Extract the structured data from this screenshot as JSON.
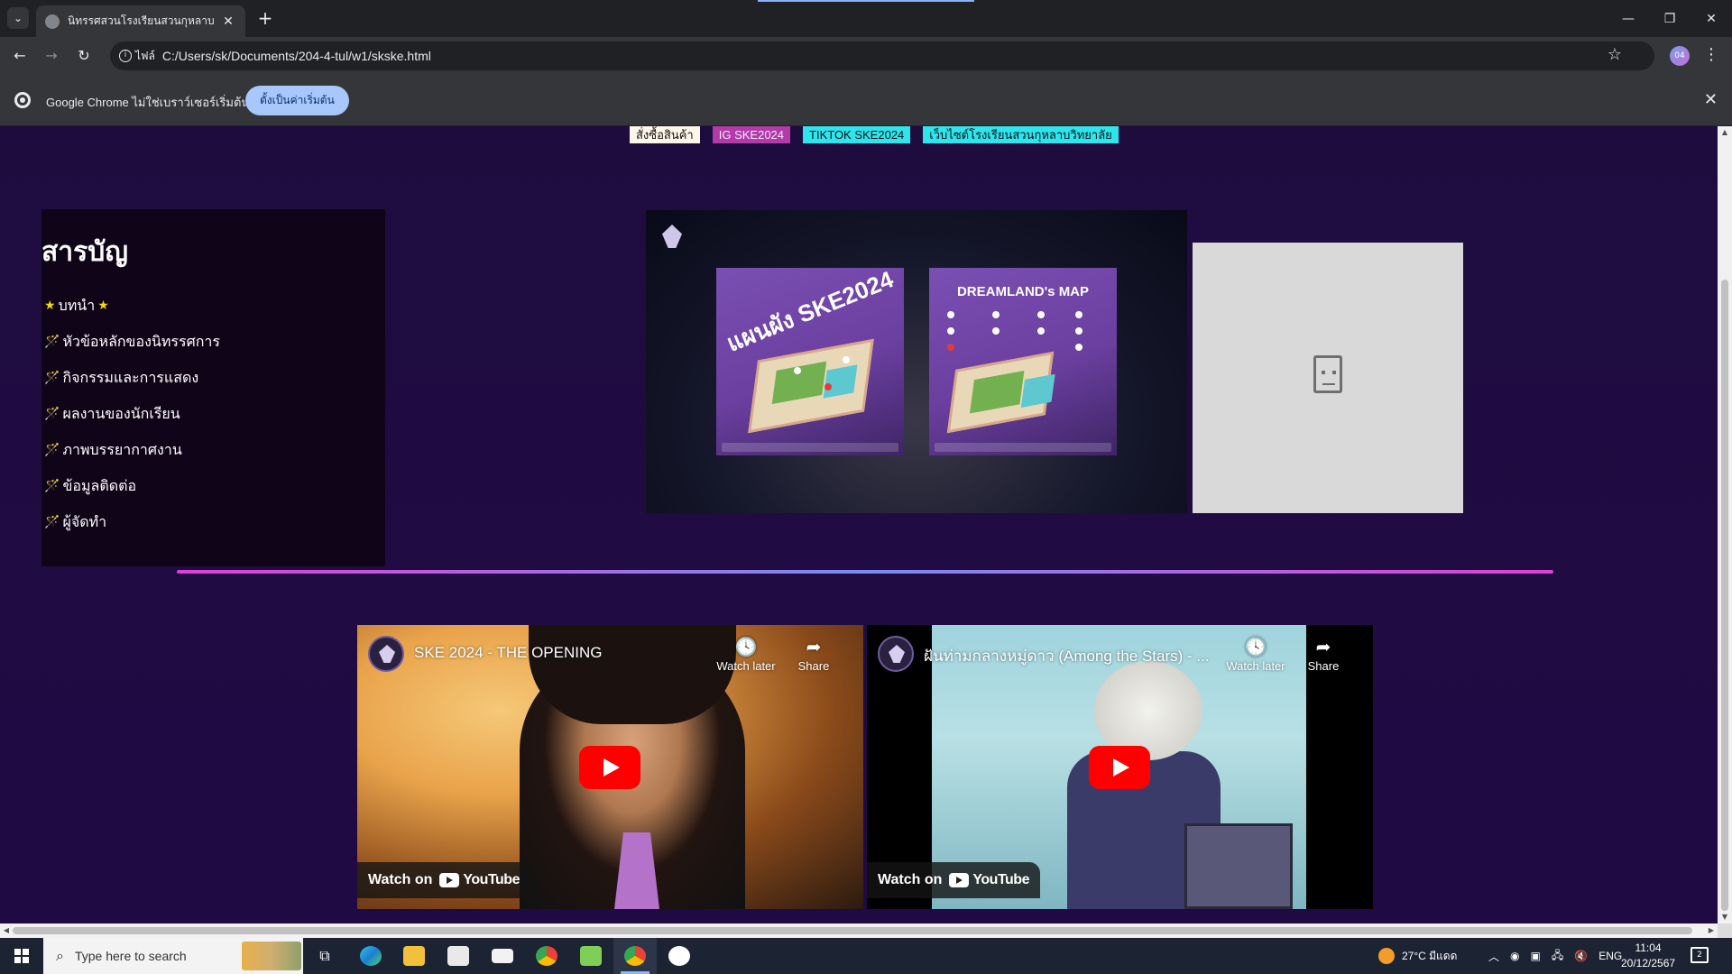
{
  "browser": {
    "tab_title": "นิทรรศสวนโรงเรียนสวนกุหลาบ",
    "address_scheme": "ไฟล์",
    "url": "C:/Users/sk/Documents/204-4-tul/w1/skske.html",
    "profile_label": "04",
    "infobar_text": "Google Chrome ไม่ใช่เบราว์เซอร์เริ่มต้น",
    "infobar_button": "ตั้งเป็นค่าเริ่มต้น"
  },
  "page": {
    "top_links": [
      "สั่งซื้อสินค้า",
      "IG SKE2024",
      "TIKTOK SKE2024",
      "เว็บไซต์โรงเรียนสวนกุหลาบวิทยาลัย"
    ],
    "toc": {
      "heading": "สารบัญ",
      "items": [
        {
          "mark": "★",
          "label": "บทนำ",
          "suffix": "★"
        },
        {
          "mark": "🪄",
          "label": "หัวข้อหลักของนิทรรศการ",
          "suffix": ""
        },
        {
          "mark": "🪄",
          "label": "กิจกรรมและการแสดง",
          "suffix": ""
        },
        {
          "mark": "🪄",
          "label": "ผลงานของนักเรียน",
          "suffix": ""
        },
        {
          "mark": "🪄",
          "label": "ภาพบรรยากาศงาน",
          "suffix": ""
        },
        {
          "mark": "🪄",
          "label": "ข้อมูลติดต่อ",
          "suffix": ""
        },
        {
          "mark": "🪄",
          "label": "ผู้จัดทำ",
          "suffix": ""
        }
      ]
    },
    "posters": [
      {
        "title": "แผนผัง SKE2024"
      },
      {
        "title": "DREAMLAND's MAP"
      }
    ],
    "videos": [
      {
        "title": "SKE 2024 - THE OPENING",
        "watch_later": "Watch later",
        "share": "Share",
        "watch_on": "Watch on",
        "brand": "YouTube"
      },
      {
        "title": "ฝันท่ามกลางหมู่ดาว (Among the Stars) - ...",
        "watch_later": "Watch later",
        "share": "Share",
        "watch_on": "Watch on",
        "brand": "YouTube"
      }
    ]
  },
  "taskbar": {
    "search_placeholder": "Type here to search",
    "weather": "27°C มีแดด",
    "language": "ENG",
    "time": "11:04",
    "date": "20/12/2567",
    "notification_count": "2"
  },
  "colors": {
    "page_bg": "#1f0c3f",
    "toc_bg": "#100518",
    "link_ig": "#b33aa8",
    "link_cyan": "#2ee5ee",
    "divider": "#e03fd5",
    "youtube_red": "#ff0000"
  }
}
